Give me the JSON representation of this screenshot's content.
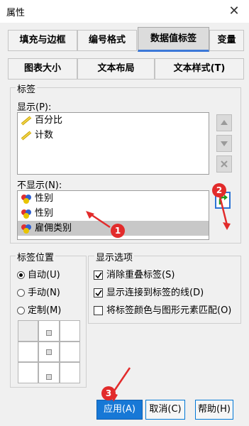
{
  "window": {
    "title": "属性",
    "close_glyph": "✕"
  },
  "tabs": {
    "row1": [
      "填充与边框",
      "编号格式",
      "数据值标签",
      "变量"
    ],
    "row2": [
      "图表大小",
      "文本布局",
      "文本样式(T)"
    ],
    "active": "数据值标签"
  },
  "labels_group": {
    "title": "标签",
    "shown_label": "显示(P):",
    "shown_items": [
      {
        "label": "百分比",
        "icon": "ruler-icon"
      },
      {
        "label": "计数",
        "icon": "ruler-icon"
      }
    ],
    "hidden_label": "不显示(N):",
    "hidden_items": [
      {
        "label": "性别",
        "icon": "nominal-variable-icon"
      },
      {
        "label": "性别",
        "icon": "nominal-variable-icon"
      },
      {
        "label": "雇佣类别",
        "icon": "nominal-variable-icon",
        "selected": true
      }
    ]
  },
  "position_group": {
    "title": "标签位置",
    "options": [
      {
        "label": "自动(U)",
        "checked": true
      },
      {
        "label": "手动(N)",
        "checked": false
      },
      {
        "label": "定制(M)",
        "checked": false
      }
    ]
  },
  "display_options": {
    "title": "显示选项",
    "options": [
      {
        "label": "消除重叠标签(S)",
        "checked": true
      },
      {
        "label": "显示连接到标签的线(D)",
        "checked": true
      },
      {
        "label": "将标签颜色与图形元素匹配(O)",
        "checked": false
      }
    ]
  },
  "buttons": {
    "apply": "应用(A)",
    "cancel": "取消(C)",
    "help": "帮助(H)"
  },
  "annotations": [
    "1",
    "2",
    "3"
  ],
  "colors": {
    "annotation": "#e22b2b",
    "accent": "#1778d6",
    "selection": "#c8c8c8"
  }
}
